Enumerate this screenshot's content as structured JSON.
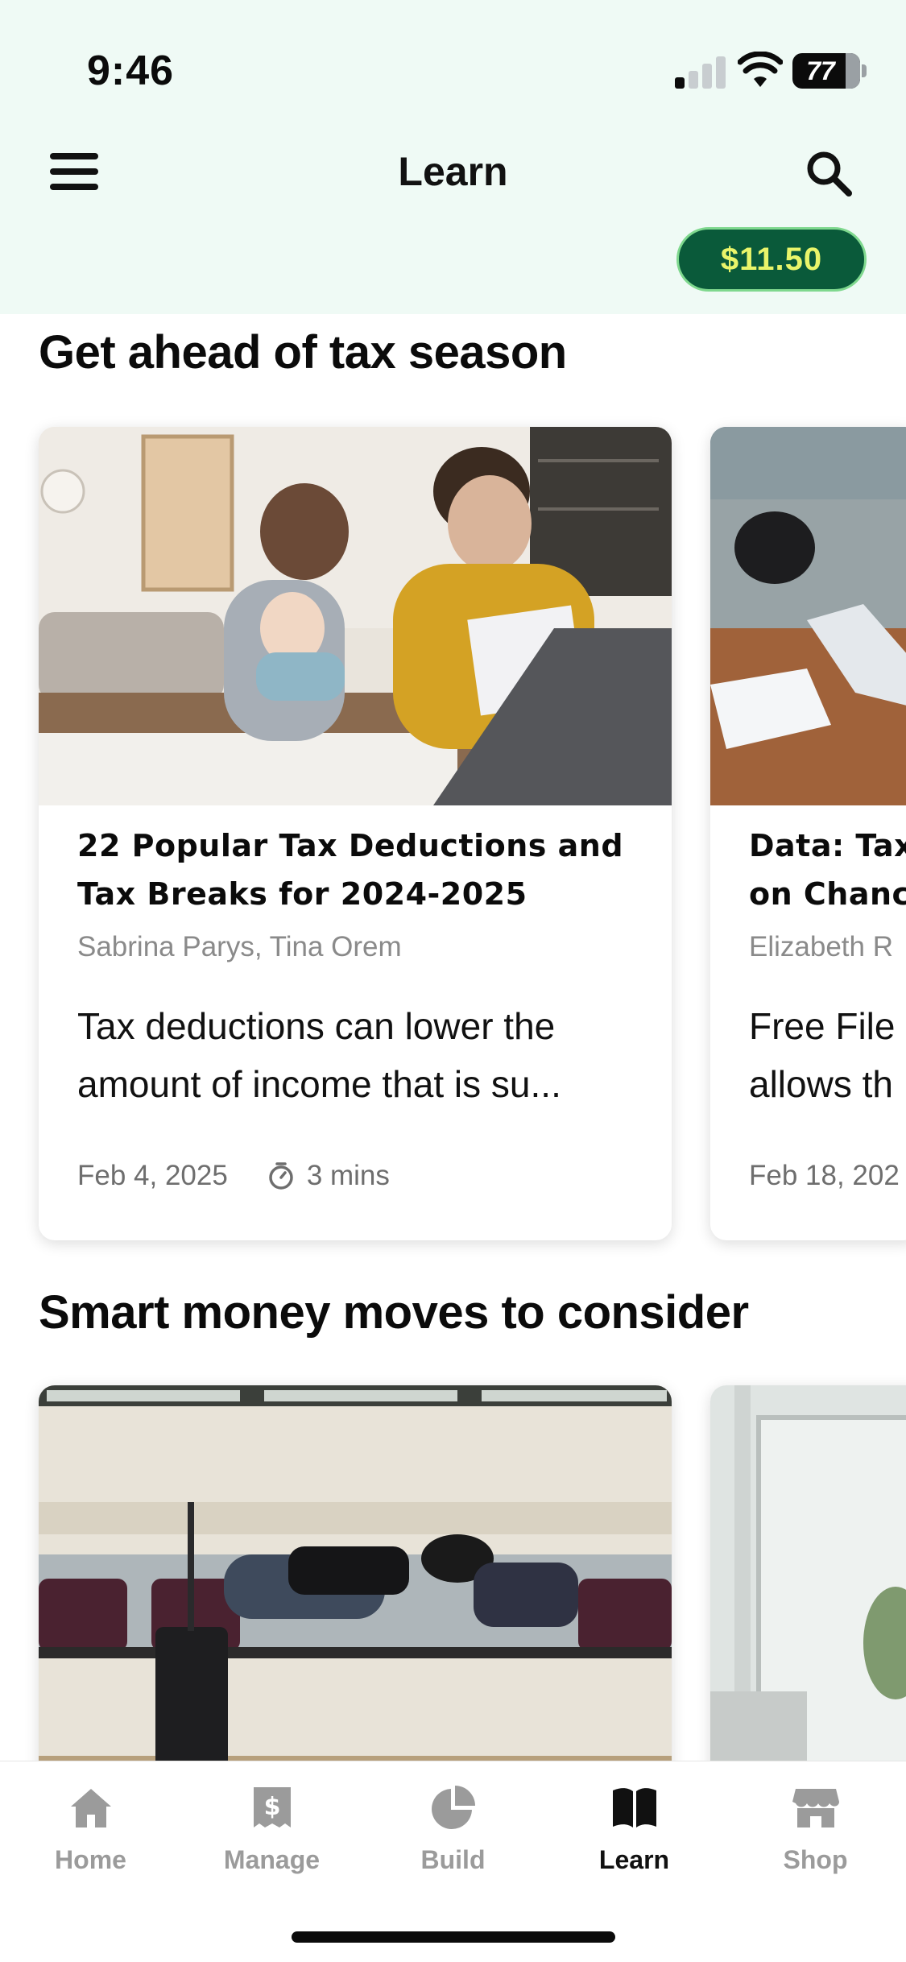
{
  "status_bar": {
    "time": "9:46",
    "battery": "77"
  },
  "header": {
    "title": "Learn",
    "balance": "$11.50"
  },
  "sections": [
    {
      "title": "Get ahead of tax season",
      "cards": [
        {
          "title": "22 Popular Tax Deductions and Tax Breaks for 2024-2025",
          "author": "Sabrina Parys, Tina Orem",
          "summary": "Tax deductions can lower the amount of income that is su...",
          "date": "Feb 4, 2025",
          "read_time": "3 mins"
        },
        {
          "title": "Data: Tax",
          "title_line2": "on Chanc",
          "author": "Elizabeth R",
          "summary": "Free File",
          "summary_line2": "allows th",
          "date": "Feb 18, 202"
        }
      ]
    },
    {
      "title": "Smart money moves to consider"
    }
  ],
  "tabs": [
    {
      "label": "Home",
      "icon": "home-icon",
      "active": false
    },
    {
      "label": "Manage",
      "icon": "dollar-bill-icon",
      "active": false
    },
    {
      "label": "Build",
      "icon": "pie-chart-icon",
      "active": false
    },
    {
      "label": "Learn",
      "icon": "open-book-icon",
      "active": true
    },
    {
      "label": "Shop",
      "icon": "storefront-icon",
      "active": false
    }
  ],
  "colors": {
    "header_bg": "#effaf5",
    "balance_bg": "#0a5a3a",
    "balance_text": "#e9f56a",
    "balance_border": "#7fd88e"
  }
}
